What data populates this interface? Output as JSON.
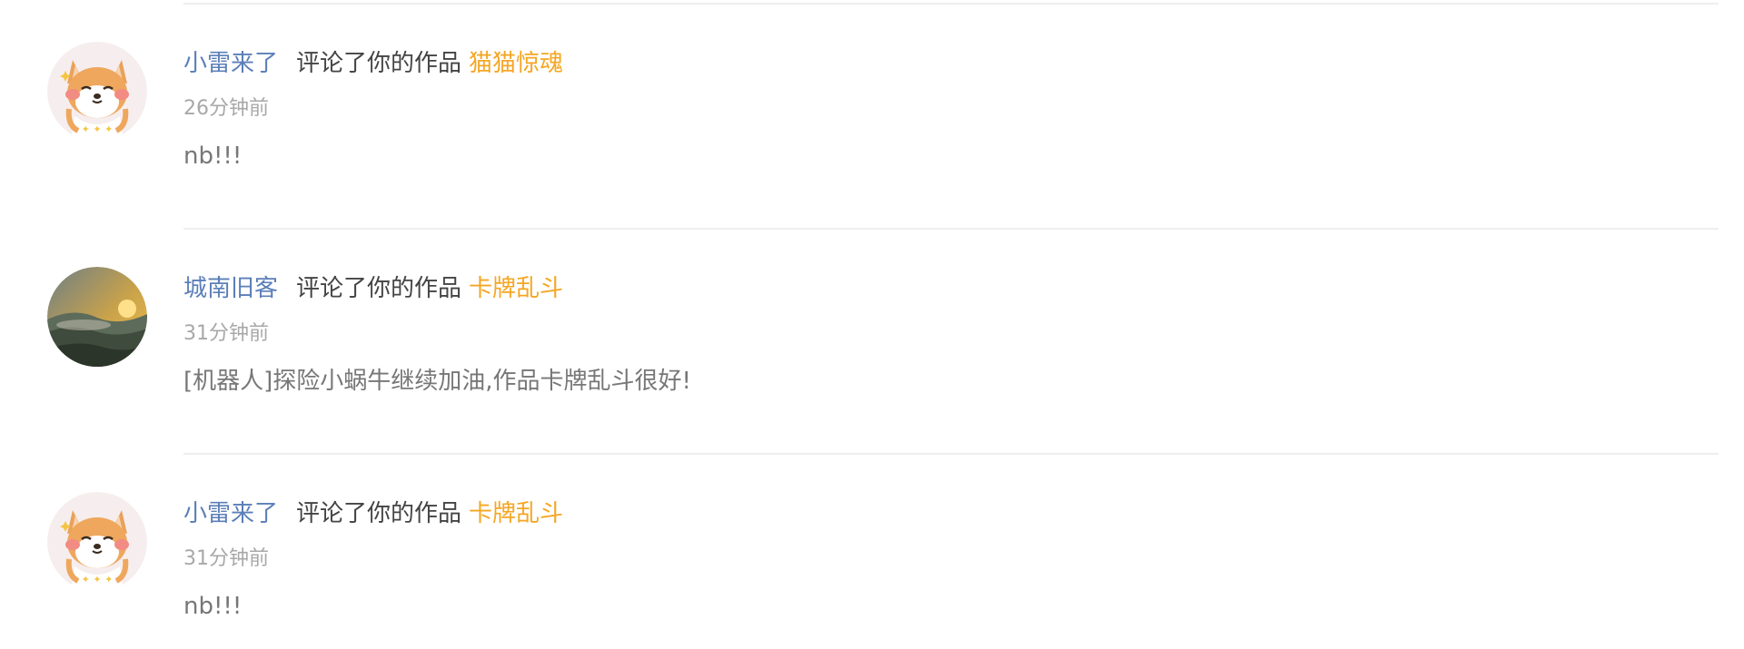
{
  "notifications": [
    {
      "avatar_icon": "shiba-dog-avatar-icon",
      "user": "小雷来了",
      "action": "评论了你的作品",
      "work": "猫猫惊魂",
      "time": "26分钟前",
      "comment": "nb!!!"
    },
    {
      "avatar_icon": "sunset-landscape-avatar-icon",
      "user": "城南旧客",
      "action": "评论了你的作品",
      "work": "卡牌乱斗",
      "time": "31分钟前",
      "comment": "[机器人]探险小蜗牛继续加油,作品卡牌乱斗很好!"
    },
    {
      "avatar_icon": "shiba-dog-avatar-icon",
      "user": "小雷来了",
      "action": "评论了你的作品",
      "work": "卡牌乱斗",
      "time": "31分钟前",
      "comment": "nb!!!"
    }
  ],
  "colors": {
    "user_name": "#5b7fb8",
    "work_title": "#f5a623",
    "timestamp": "#a8a8a8",
    "comment": "#777777",
    "divider": "#eeeeee"
  }
}
